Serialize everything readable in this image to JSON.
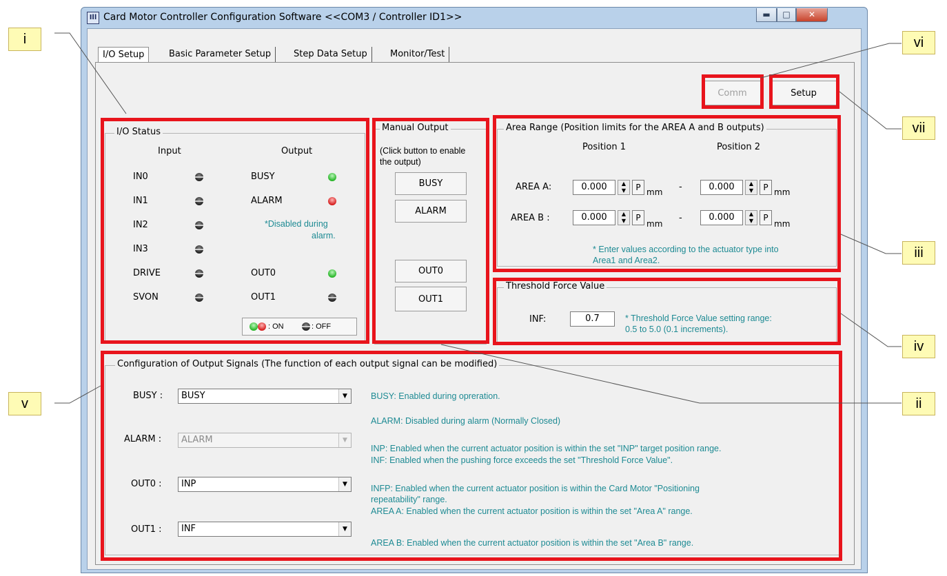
{
  "window": {
    "title": "Card Motor Controller Configuration Software <<COM3 / Controller ID1>>",
    "app_icon": "Ill",
    "controls": [
      "minimize-icon",
      "maximize-icon",
      "close-icon"
    ]
  },
  "tabs": [
    "I/O Setup",
    "Basic Parameter Setup",
    "Step Data Setup",
    "Monitor/Test"
  ],
  "toolbar": {
    "comm": "Comm",
    "setup": "Setup"
  },
  "io_status": {
    "title": "I/O Status",
    "input_header": "Input",
    "output_header": "Output",
    "inputs": [
      "IN0",
      "IN1",
      "IN2",
      "IN3",
      "DRIVE",
      "SVON"
    ],
    "outputs": [
      "BUSY",
      "ALARM",
      "OUT0",
      "OUT1"
    ],
    "alarm_note_1": "*Disabled during",
    "alarm_note_2": "alarm.",
    "legend_on": ": ON",
    "legend_off": ": OFF",
    "led_states": {
      "BUSY": "green",
      "ALARM": "red",
      "OUT0": "green",
      "OUT1": "off"
    }
  },
  "manual_output": {
    "title": "Manual Output",
    "hint_1": "(Click button to enable",
    "hint_2": "the output)",
    "buttons": [
      "BUSY",
      "ALARM",
      "OUT0",
      "OUT1"
    ]
  },
  "area_range": {
    "title": "Area Range (Position limits for the AREA A and B outputs)",
    "pos1": "Position 1",
    "pos2": "Position 2",
    "area_a_label": "AREA A:",
    "area_b_label": "AREA B :",
    "values": [
      "0.000",
      "0.000",
      "0.000",
      "0.000"
    ],
    "p_button": "P",
    "unit": "mm",
    "dash": "-",
    "note_1": "* Enter values according to the actuator type into",
    "note_2": "Area1 and Area2."
  },
  "threshold": {
    "title": "Threshold Force Value",
    "label": "INF:",
    "value": "0.7",
    "note_1": "* Threshold Force Value setting range:",
    "note_2": "0.5 to 5.0 (0.1 increments)."
  },
  "config": {
    "title": "Configuration of Output Signals (The function of each output signal can be modified)",
    "rows": [
      {
        "label": "BUSY :",
        "value": "BUSY"
      },
      {
        "label": "ALARM :",
        "value": "ALARM"
      },
      {
        "label": "OUT0 :",
        "value": "INP"
      },
      {
        "label": "OUT1 :",
        "value": "INF"
      }
    ],
    "desc": [
      "BUSY: Enabled during opreration.",
      "ALARM: Disabled during alarm (Normally Closed)",
      "INP: Enabled when the current actuator position is within the set \"INP\" target position range.",
      "INF: Enabled when the pushing force exceeds the set \"Threshold Force Value\".",
      "INFP: Enabled when the current actuator position is within the Card Motor \"Positioning",
      "repeatability\" range.",
      "AREA A: Enabled when the current actuator position is within the set \"Area A\" range.",
      "AREA B: Enabled when the current actuator position is within the set \"Area B\" range."
    ]
  },
  "callouts": {
    "i": "i",
    "ii": "ii",
    "iii": "iii",
    "iv": "iv",
    "v": "v",
    "vi": "vi",
    "vii": "vii"
  },
  "colors": {
    "highlight": "#e8141c",
    "callout_fill": "#fefbb5",
    "note_text": "#1d8a93"
  }
}
